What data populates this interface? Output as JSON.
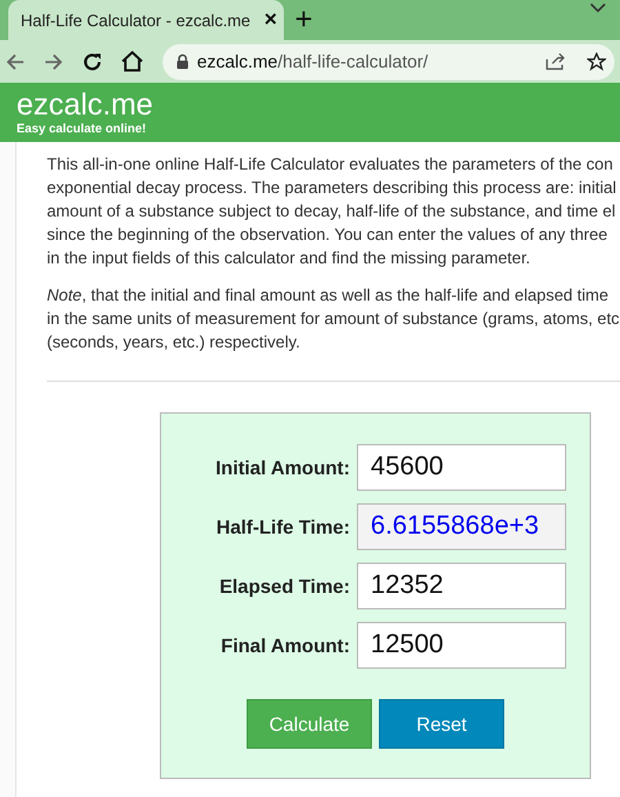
{
  "browser": {
    "tab_title": "Half-Life Calculator - ezcalc.me",
    "close": "×",
    "new_tab": "+",
    "url_domain": "ezcalc.me",
    "url_path": "/half-life-calculator/"
  },
  "site": {
    "logo": "ezcalc.me",
    "tagline": "Easy calculate online!"
  },
  "intro_lines": [
    "This all-in-one online Half-Life Calculator evaluates the parameters of the con",
    "exponential decay process. The parameters describing this process are: initial",
    "amount of a substance subject to decay, half-life of the substance, and time el",
    "since the beginning of the observation. You can enter the values of any three",
    "in the input fields of this calculator and find the missing parameter."
  ],
  "note_lines": [
    "*Note*, that the initial and final amount as well as the half-life and elapsed time",
    "in the same units of measurement for amount of substance (grams, atoms, etc",
    "(seconds, years, etc.) respectively."
  ],
  "fields": [
    {
      "label": "Initial Amount:",
      "value": "45600",
      "computed": false
    },
    {
      "label": "Half-Life Time:",
      "value": "6.6155868e+3",
      "computed": true
    },
    {
      "label": "Elapsed Time:",
      "value": "12352",
      "computed": false
    },
    {
      "label": "Final Amount:",
      "value": "12500",
      "computed": false
    }
  ],
  "buttons": [
    {
      "label": "Calculate",
      "kind": "primary"
    },
    {
      "label": "Reset",
      "kind": "secondary"
    }
  ]
}
